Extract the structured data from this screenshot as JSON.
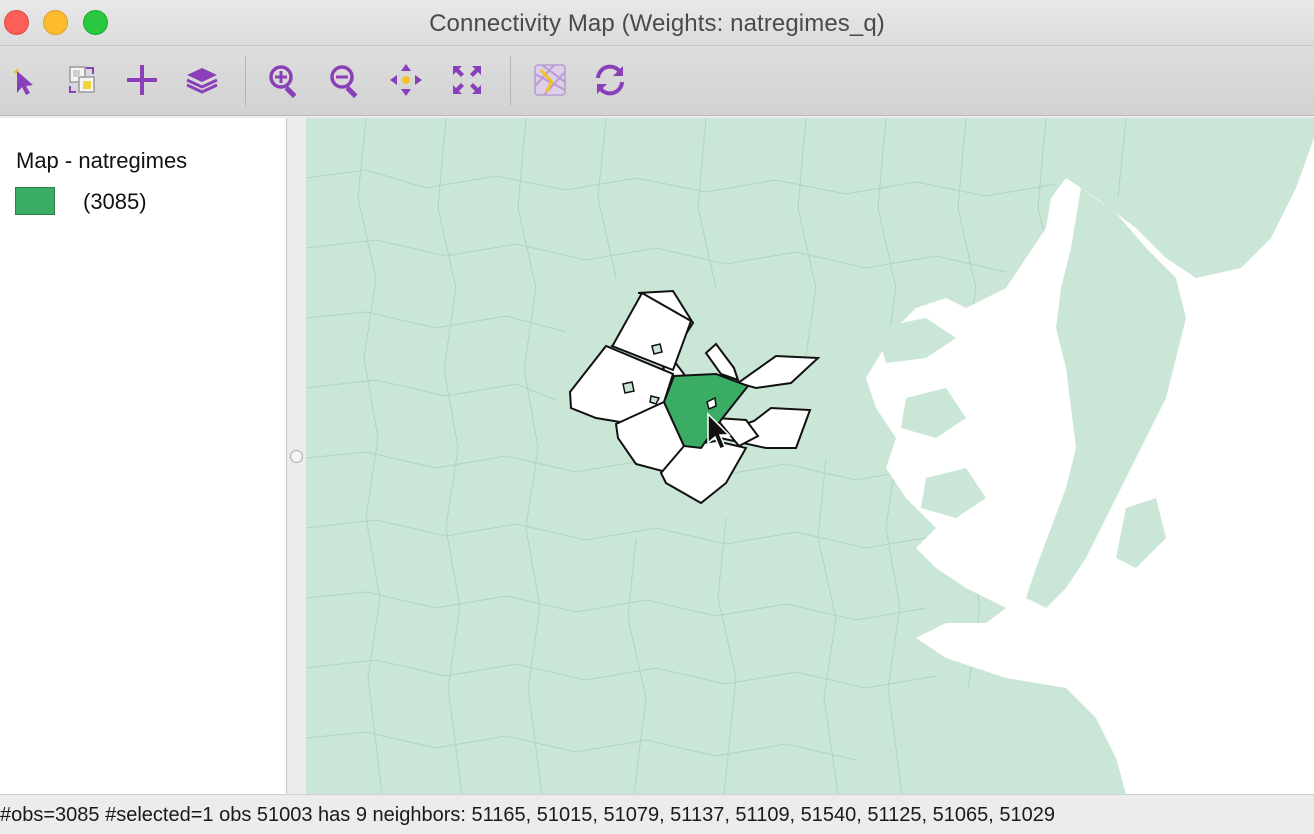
{
  "window": {
    "title": "Connectivity Map (Weights: natregimes_q)"
  },
  "toolbar": {
    "tools": [
      {
        "name": "select-tool",
        "icon": "pointer-arrow-icon"
      },
      {
        "name": "select-copy-tool",
        "icon": "copy-selection-icon"
      },
      {
        "name": "add-tool",
        "icon": "plus-icon"
      },
      {
        "name": "layers-tool",
        "icon": "layers-icon"
      },
      {
        "name": "zoom-in-tool",
        "icon": "zoom-in-icon"
      },
      {
        "name": "zoom-out-tool",
        "icon": "zoom-out-icon"
      },
      {
        "name": "pan-tool",
        "icon": "pan-arrows-icon"
      },
      {
        "name": "full-extent-tool",
        "icon": "full-extent-icon"
      },
      {
        "name": "basemap-tool",
        "icon": "basemap-icon"
      },
      {
        "name": "refresh-tool",
        "icon": "refresh-icon"
      }
    ],
    "accent": "#8a3fb8"
  },
  "legend": {
    "title": "Map - natregimes",
    "items": [
      {
        "label": "(3085)",
        "color": "#3aac63"
      }
    ]
  },
  "map": {
    "background_color": "#c9e6d6",
    "water_color": "#ffffff",
    "selected_color": "#3aac63",
    "neighbor_color": "#ffffff"
  },
  "status": {
    "text": "#obs=3085 #selected=1  obs 51003 has 9 neighbors: 51165, 51015, 51079, 51137, 51109, 51540, 51125, 51065, 51029"
  }
}
